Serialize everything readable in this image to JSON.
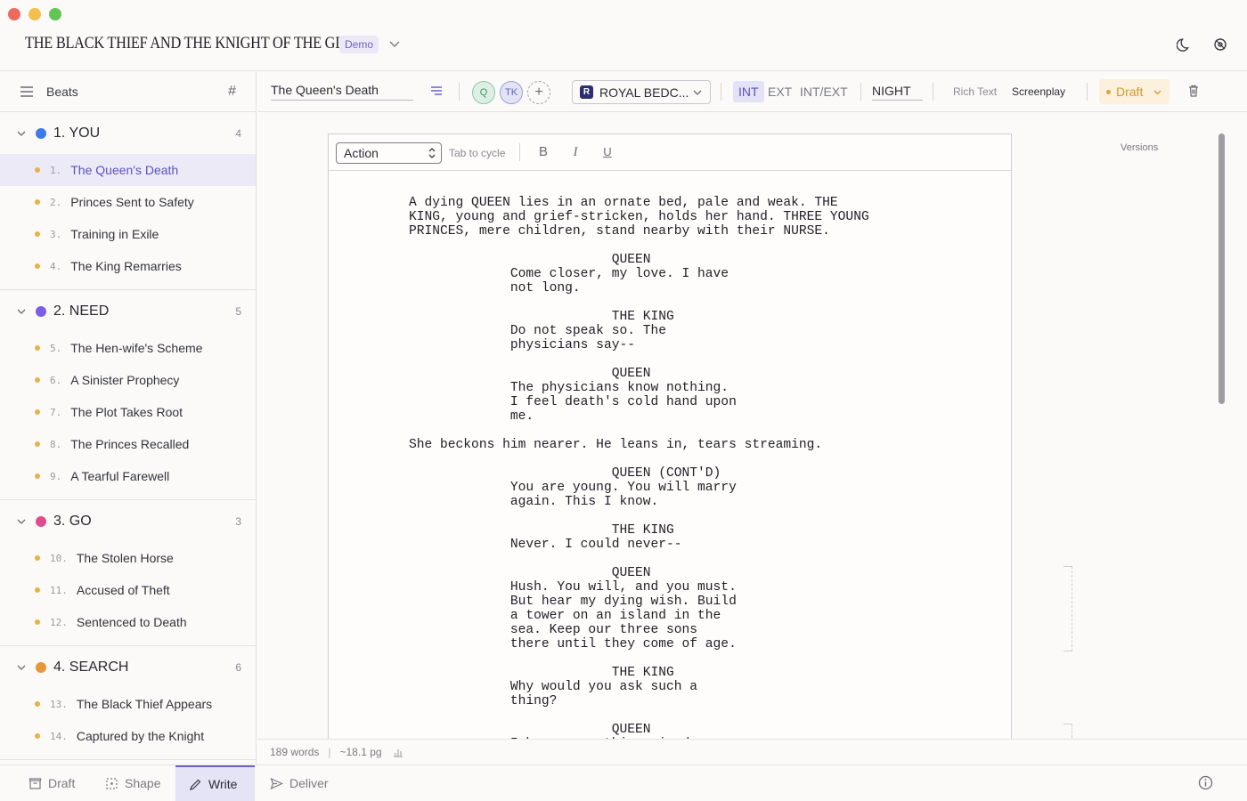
{
  "window": {
    "title": "THE BLACK THIEF AND THE KNIGHT OF THE GLEN",
    "badge": "Demo"
  },
  "sidebar": {
    "header_label": "Beats",
    "hash_label": "#",
    "acts": [
      {
        "title": "1. YOU",
        "count": "4",
        "color": "#3f7be6",
        "beats": [
          {
            "num": "1.",
            "label": "The Queen's Death"
          },
          {
            "num": "2.",
            "label": "Princes Sent to Safety"
          },
          {
            "num": "3.",
            "label": "Training in Exile"
          },
          {
            "num": "4.",
            "label": "The King Remarries"
          }
        ]
      },
      {
        "title": "2. NEED",
        "count": "5",
        "color": "#7a5ee8",
        "beats": [
          {
            "num": "5.",
            "label": "The Hen-wife's Scheme"
          },
          {
            "num": "6.",
            "label": "A Sinister Prophecy"
          },
          {
            "num": "7.",
            "label": "The Plot Takes Root"
          },
          {
            "num": "8.",
            "label": "The Princes Recalled"
          },
          {
            "num": "9.",
            "label": "A Tearful Farewell"
          }
        ]
      },
      {
        "title": "3. GO",
        "count": "3",
        "color": "#dc4f8c",
        "beats": [
          {
            "num": "10.",
            "label": "The Stolen Horse"
          },
          {
            "num": "11.",
            "label": "Accused of Theft"
          },
          {
            "num": "12.",
            "label": "Sentenced to Death"
          }
        ]
      },
      {
        "title": "4. SEARCH",
        "count": "6",
        "color": "#e8963a",
        "beats": [
          {
            "num": "13.",
            "label": "The Black Thief Appears"
          },
          {
            "num": "14.",
            "label": "Captured by the Knight"
          }
        ]
      }
    ],
    "active_beat": "The Queen's Death"
  },
  "toolbar": {
    "scene_name": "The Queen's Death",
    "avatar_q": "Q",
    "avatar_tk": "TK",
    "avatar_add": "+",
    "location_badge": "R",
    "location": "ROYAL BEDC...",
    "int_label": "INT",
    "ext_label": "EXT",
    "intext_label": "INT/EXT",
    "time_of_day": "NIGHT",
    "rich_text": "Rich Text",
    "screenplay": "Screenplay",
    "status": "Draft",
    "status_color": "#d49a2e",
    "accent_color": "#6c63c9"
  },
  "editor": {
    "element_type": "Action",
    "tab_hint": "Tab to cycle",
    "bold": "B",
    "italic": "I",
    "underline": "U",
    "script_lines": [
      "A dying QUEEN lies in an ornate bed, pale and weak. THE",
      "KING, young and grief-stricken, holds her hand. THREE YOUNG",
      "PRINCES, mere children, stand nearby with their NURSE.",
      "",
      "                          QUEEN",
      "             Come closer, my love. I have",
      "             not long.",
      "",
      "                          THE KING",
      "             Do not speak so. The",
      "             physicians say--",
      "",
      "                          QUEEN",
      "             The physicians know nothing.",
      "             I feel death's cold hand upon",
      "             me.",
      "",
      "She beckons him nearer. He leans in, tears streaming.",
      "",
      "                          QUEEN (CONT'D)",
      "             You are young. You will marry",
      "             again. This I know.",
      "",
      "                          THE KING",
      "             Never. I could never--",
      "",
      "                          QUEEN",
      "             Hush. You will, and you must.",
      "             But hear my dying wish. Build",
      "             a tower on an island in the",
      "             sea. Keep our three sons",
      "             there until they come of age.",
      "",
      "                          THE KING",
      "             Why would you ask such a",
      "             thing?",
      "",
      "                          QUEEN",
      "             I have seen things in dreams."
    ]
  },
  "right_panel": {
    "versions_label": "Versions"
  },
  "statusbar": {
    "words": "189 words",
    "sep": "|",
    "pages": "~18.1 pg"
  },
  "modes": {
    "draft": "Draft",
    "shape": "Shape",
    "write": "Write",
    "deliver": "Deliver",
    "active": "Write"
  }
}
